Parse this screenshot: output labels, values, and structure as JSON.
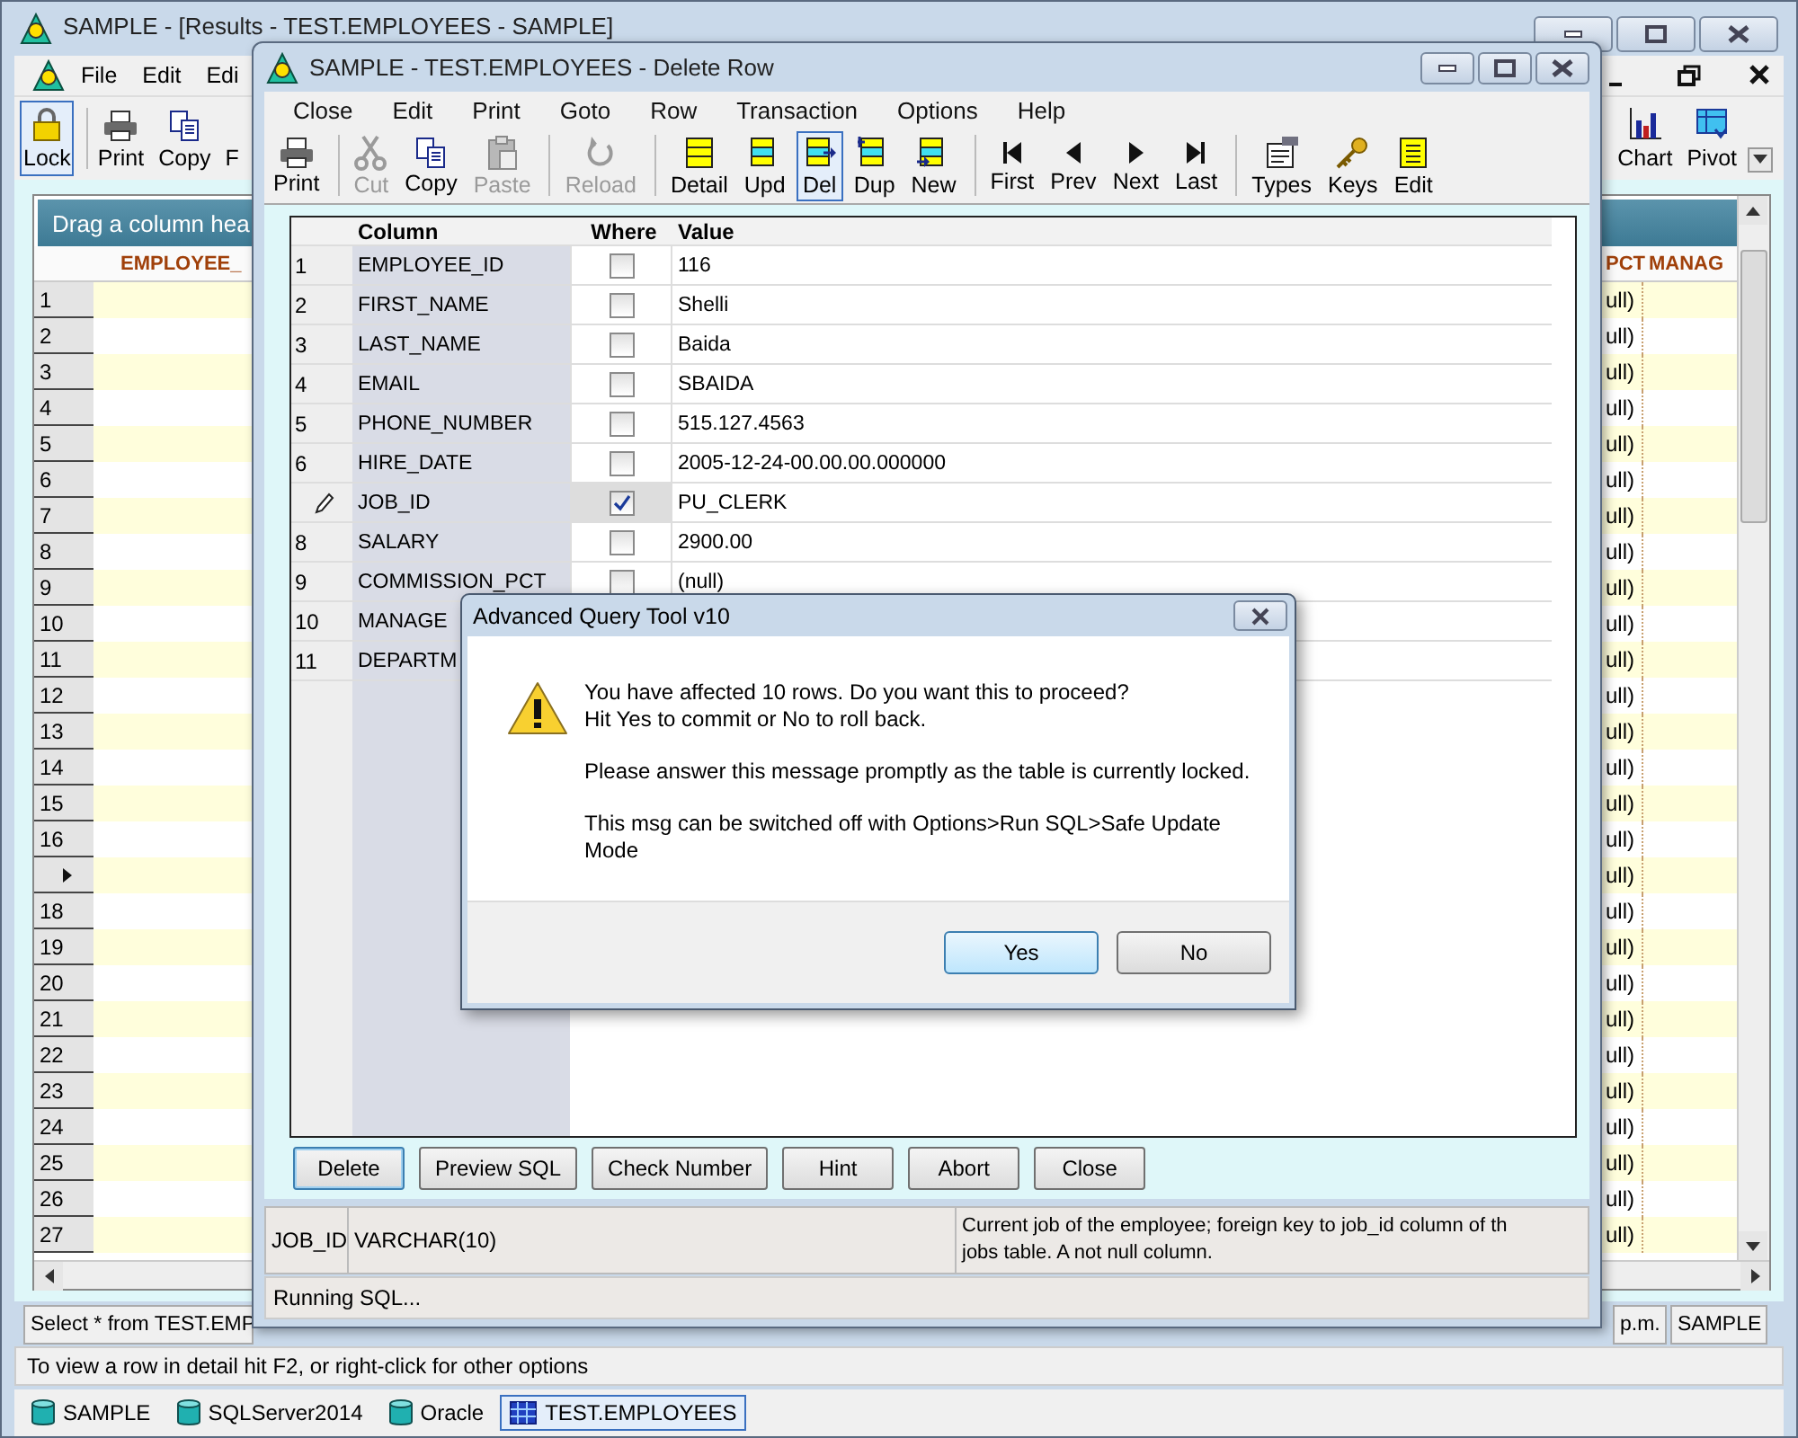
{
  "main_window": {
    "title": "SAMPLE - [Results - TEST.EMPLOYEES - SAMPLE]",
    "menu": [
      "File",
      "Edit",
      "Edi"
    ],
    "toolbar": [
      {
        "label": "Lock",
        "kind": "lock",
        "selected": true
      },
      {
        "label": "Print",
        "kind": "print",
        "selected": false
      },
      {
        "label": "Copy",
        "kind": "copy",
        "selected": false
      },
      {
        "label": "F",
        "kind": "covered",
        "selected": false
      }
    ],
    "toolbar_right": [
      {
        "label": "Chart",
        "kind": "chart"
      },
      {
        "label": "Pivot",
        "kind": "pivot"
      }
    ],
    "grid": {
      "group_panel": "Drag a column hea",
      "columns": [
        "EMPLOYEE_",
        "PCT",
        "MANAG"
      ],
      "rows": [
        {
          "number": "1",
          "current": false,
          "pct": "ull)"
        },
        {
          "number": "2",
          "current": false,
          "pct": "ull)"
        },
        {
          "number": "3",
          "current": false,
          "pct": "ull)"
        },
        {
          "number": "4",
          "current": false,
          "pct": "ull)"
        },
        {
          "number": "5",
          "current": false,
          "pct": "ull)"
        },
        {
          "number": "6",
          "current": false,
          "pct": "ull)"
        },
        {
          "number": "7",
          "current": false,
          "pct": "ull)"
        },
        {
          "number": "8",
          "current": false,
          "pct": "ull)"
        },
        {
          "number": "9",
          "current": false,
          "pct": "ull)"
        },
        {
          "number": "10",
          "current": false,
          "pct": "ull)"
        },
        {
          "number": "11",
          "current": false,
          "pct": "ull)"
        },
        {
          "number": "12",
          "current": false,
          "pct": "ull)"
        },
        {
          "number": "13",
          "current": false,
          "pct": "ull)"
        },
        {
          "number": "14",
          "current": false,
          "pct": "ull)"
        },
        {
          "number": "15",
          "current": false,
          "pct": "ull)"
        },
        {
          "number": "16",
          "current": false,
          "pct": "ull)"
        },
        {
          "current": true,
          "pct": "ull)"
        },
        {
          "number": "18",
          "current": false,
          "pct": "ull)"
        },
        {
          "number": "19",
          "current": false,
          "pct": "ull)"
        },
        {
          "number": "20",
          "current": false,
          "pct": "ull)"
        },
        {
          "number": "21",
          "current": false,
          "pct": "ull)"
        },
        {
          "number": "22",
          "current": false,
          "pct": "ull)"
        },
        {
          "number": "23",
          "current": false,
          "pct": "ull)"
        },
        {
          "number": "24",
          "current": false,
          "pct": "ull)"
        },
        {
          "number": "25",
          "current": false,
          "pct": "ull)"
        },
        {
          "number": "26",
          "current": false,
          "pct": "ull)"
        },
        {
          "number": "27",
          "current": false,
          "pct": "ull)"
        }
      ]
    },
    "status_bar": [
      "Select * from TEST.EMP",
      "p.m.",
      "SAMPLE"
    ],
    "hint": "To view a row in detail hit F2, or right-click for other options",
    "connections": [
      {
        "label": "SAMPLE",
        "kind": "database",
        "selected": false
      },
      {
        "label": "SQLServer2014",
        "kind": "database",
        "selected": false
      },
      {
        "label": "Oracle",
        "kind": "database",
        "selected": false
      },
      {
        "label": "TEST.EMPLOYEES",
        "kind": "table",
        "selected": true
      }
    ]
  },
  "child_window": {
    "title": "SAMPLE - TEST.EMPLOYEES - Delete Row",
    "menu": [
      "Close",
      "Edit",
      "Print",
      "Goto",
      "Row",
      "Transaction",
      "Options",
      "Help"
    ],
    "toolbar": [
      [
        {
          "label": "Print",
          "kind": "print",
          "disabled": false,
          "selected": false
        }
      ],
      [
        {
          "label": "Cut",
          "kind": "cut",
          "disabled": true,
          "selected": false
        },
        {
          "label": "Copy",
          "kind": "copy",
          "disabled": false,
          "selected": false
        },
        {
          "label": "Paste",
          "kind": "paste",
          "disabled": true,
          "selected": false
        }
      ],
      [
        {
          "label": "Reload",
          "kind": "reload",
          "disabled": true,
          "selected": false
        }
      ],
      [
        {
          "label": "Detail",
          "kind": "detail",
          "disabled": false,
          "selected": false
        },
        {
          "label": "Upd",
          "kind": "upd",
          "disabled": false,
          "selected": false
        },
        {
          "label": "Del",
          "kind": "del",
          "disabled": false,
          "selected": true
        },
        {
          "label": "Dup",
          "kind": "dup",
          "disabled": false,
          "selected": false
        },
        {
          "label": "New",
          "kind": "new",
          "disabled": false,
          "selected": false
        }
      ],
      [
        {
          "label": "First",
          "kind": "first",
          "disabled": false,
          "selected": false
        },
        {
          "label": "Prev",
          "kind": "prev",
          "disabled": false,
          "selected": false
        },
        {
          "label": "Next",
          "kind": "next",
          "disabled": false,
          "selected": false
        },
        {
          "label": "Last",
          "kind": "last",
          "disabled": false,
          "selected": false
        }
      ],
      [
        {
          "label": "Types",
          "kind": "types",
          "disabled": false,
          "selected": false
        },
        {
          "label": "Keys",
          "kind": "keys",
          "disabled": false,
          "selected": false
        },
        {
          "label": "Edit",
          "kind": "edit",
          "disabled": false,
          "selected": false
        }
      ]
    ],
    "grid": {
      "columns": [
        "Column",
        "Where",
        "Value"
      ],
      "rows": [
        {
          "number": "1",
          "editing": false,
          "column": "EMPLOYEE_ID",
          "where": false,
          "value": "116"
        },
        {
          "number": "2",
          "editing": false,
          "column": "FIRST_NAME",
          "where": false,
          "value": "Shelli"
        },
        {
          "number": "3",
          "editing": false,
          "column": "LAST_NAME",
          "where": false,
          "value": "Baida"
        },
        {
          "number": "4",
          "editing": false,
          "column": "EMAIL",
          "where": false,
          "value": "SBAIDA"
        },
        {
          "number": "5",
          "editing": false,
          "column": "PHONE_NUMBER",
          "where": false,
          "value": "515.127.4563"
        },
        {
          "number": "6",
          "editing": false,
          "column": "HIRE_DATE",
          "where": false,
          "value": "2005-12-24-00.00.00.000000"
        },
        {
          "editing": true,
          "column": "JOB_ID",
          "where": true,
          "value": "PU_CLERK"
        },
        {
          "number": "8",
          "editing": false,
          "column": "SALARY",
          "where": false,
          "value": "2900.00"
        },
        {
          "number": "9",
          "editing": false,
          "column": "COMMISSION_PCT",
          "where": false,
          "value": "(null)"
        },
        {
          "number": "10",
          "editing": false,
          "column": "MANAGE"
        },
        {
          "number": "11",
          "editing": false,
          "column": "DEPARTM"
        }
      ]
    },
    "buttons": [
      {
        "label": "Delete",
        "selected": true
      },
      {
        "label": "Preview SQL",
        "selected": false
      },
      {
        "label": "Check Number",
        "selected": false
      },
      {
        "label": "Hint",
        "selected": false
      },
      {
        "label": "Abort",
        "selected": false
      },
      {
        "label": "Close",
        "selected": false
      }
    ],
    "info": {
      "column": "JOB_ID",
      "type": "VARCHAR(10)",
      "description": [
        "Current job of the employee; foreign key to job_id column of th",
        "jobs table. A not null column."
      ]
    },
    "status": "Running SQL..."
  },
  "dialog": {
    "title": "Advanced Query Tool v10",
    "paragraphs": [
      [
        "You have affected 10 rows. Do you want this to proceed?",
        "Hit Yes to commit or No to roll back."
      ],
      [
        "Please answer this message promptly as the table is currently locked."
      ],
      [
        "This msg can be switched off with Options>Run SQL>Safe Update Mode"
      ]
    ],
    "buttons": [
      {
        "label": "Yes",
        "selected": true
      },
      {
        "label": "No",
        "selected": false
      }
    ]
  }
}
